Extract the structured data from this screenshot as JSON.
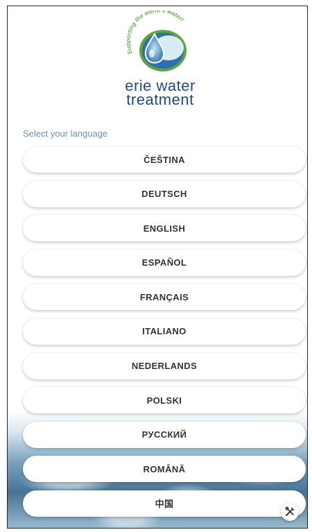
{
  "brand": {
    "tagline": "Supporting the world's water!",
    "name_line1": "erie water",
    "name_line2": "treatment"
  },
  "prompt": "Select your language",
  "languages": [
    {
      "label": "ČEŠTINA"
    },
    {
      "label": "DEUTSCH"
    },
    {
      "label": "ENGLISH"
    },
    {
      "label": "ESPAÑOL"
    },
    {
      "label": "FRANÇAIS"
    },
    {
      "label": "ITALIANO"
    },
    {
      "label": "NEDERLANDS"
    },
    {
      "label": "POLSKI"
    },
    {
      "label": "РУССКИЙ"
    },
    {
      "label": "ROMÂNĂ"
    },
    {
      "label": "中国"
    }
  ],
  "icons": {
    "tools": "tools-icon"
  },
  "colors": {
    "brand_blue": "#1f4a8a",
    "brand_green": "#6ab04c",
    "prompt_text": "#6f8fb0"
  }
}
